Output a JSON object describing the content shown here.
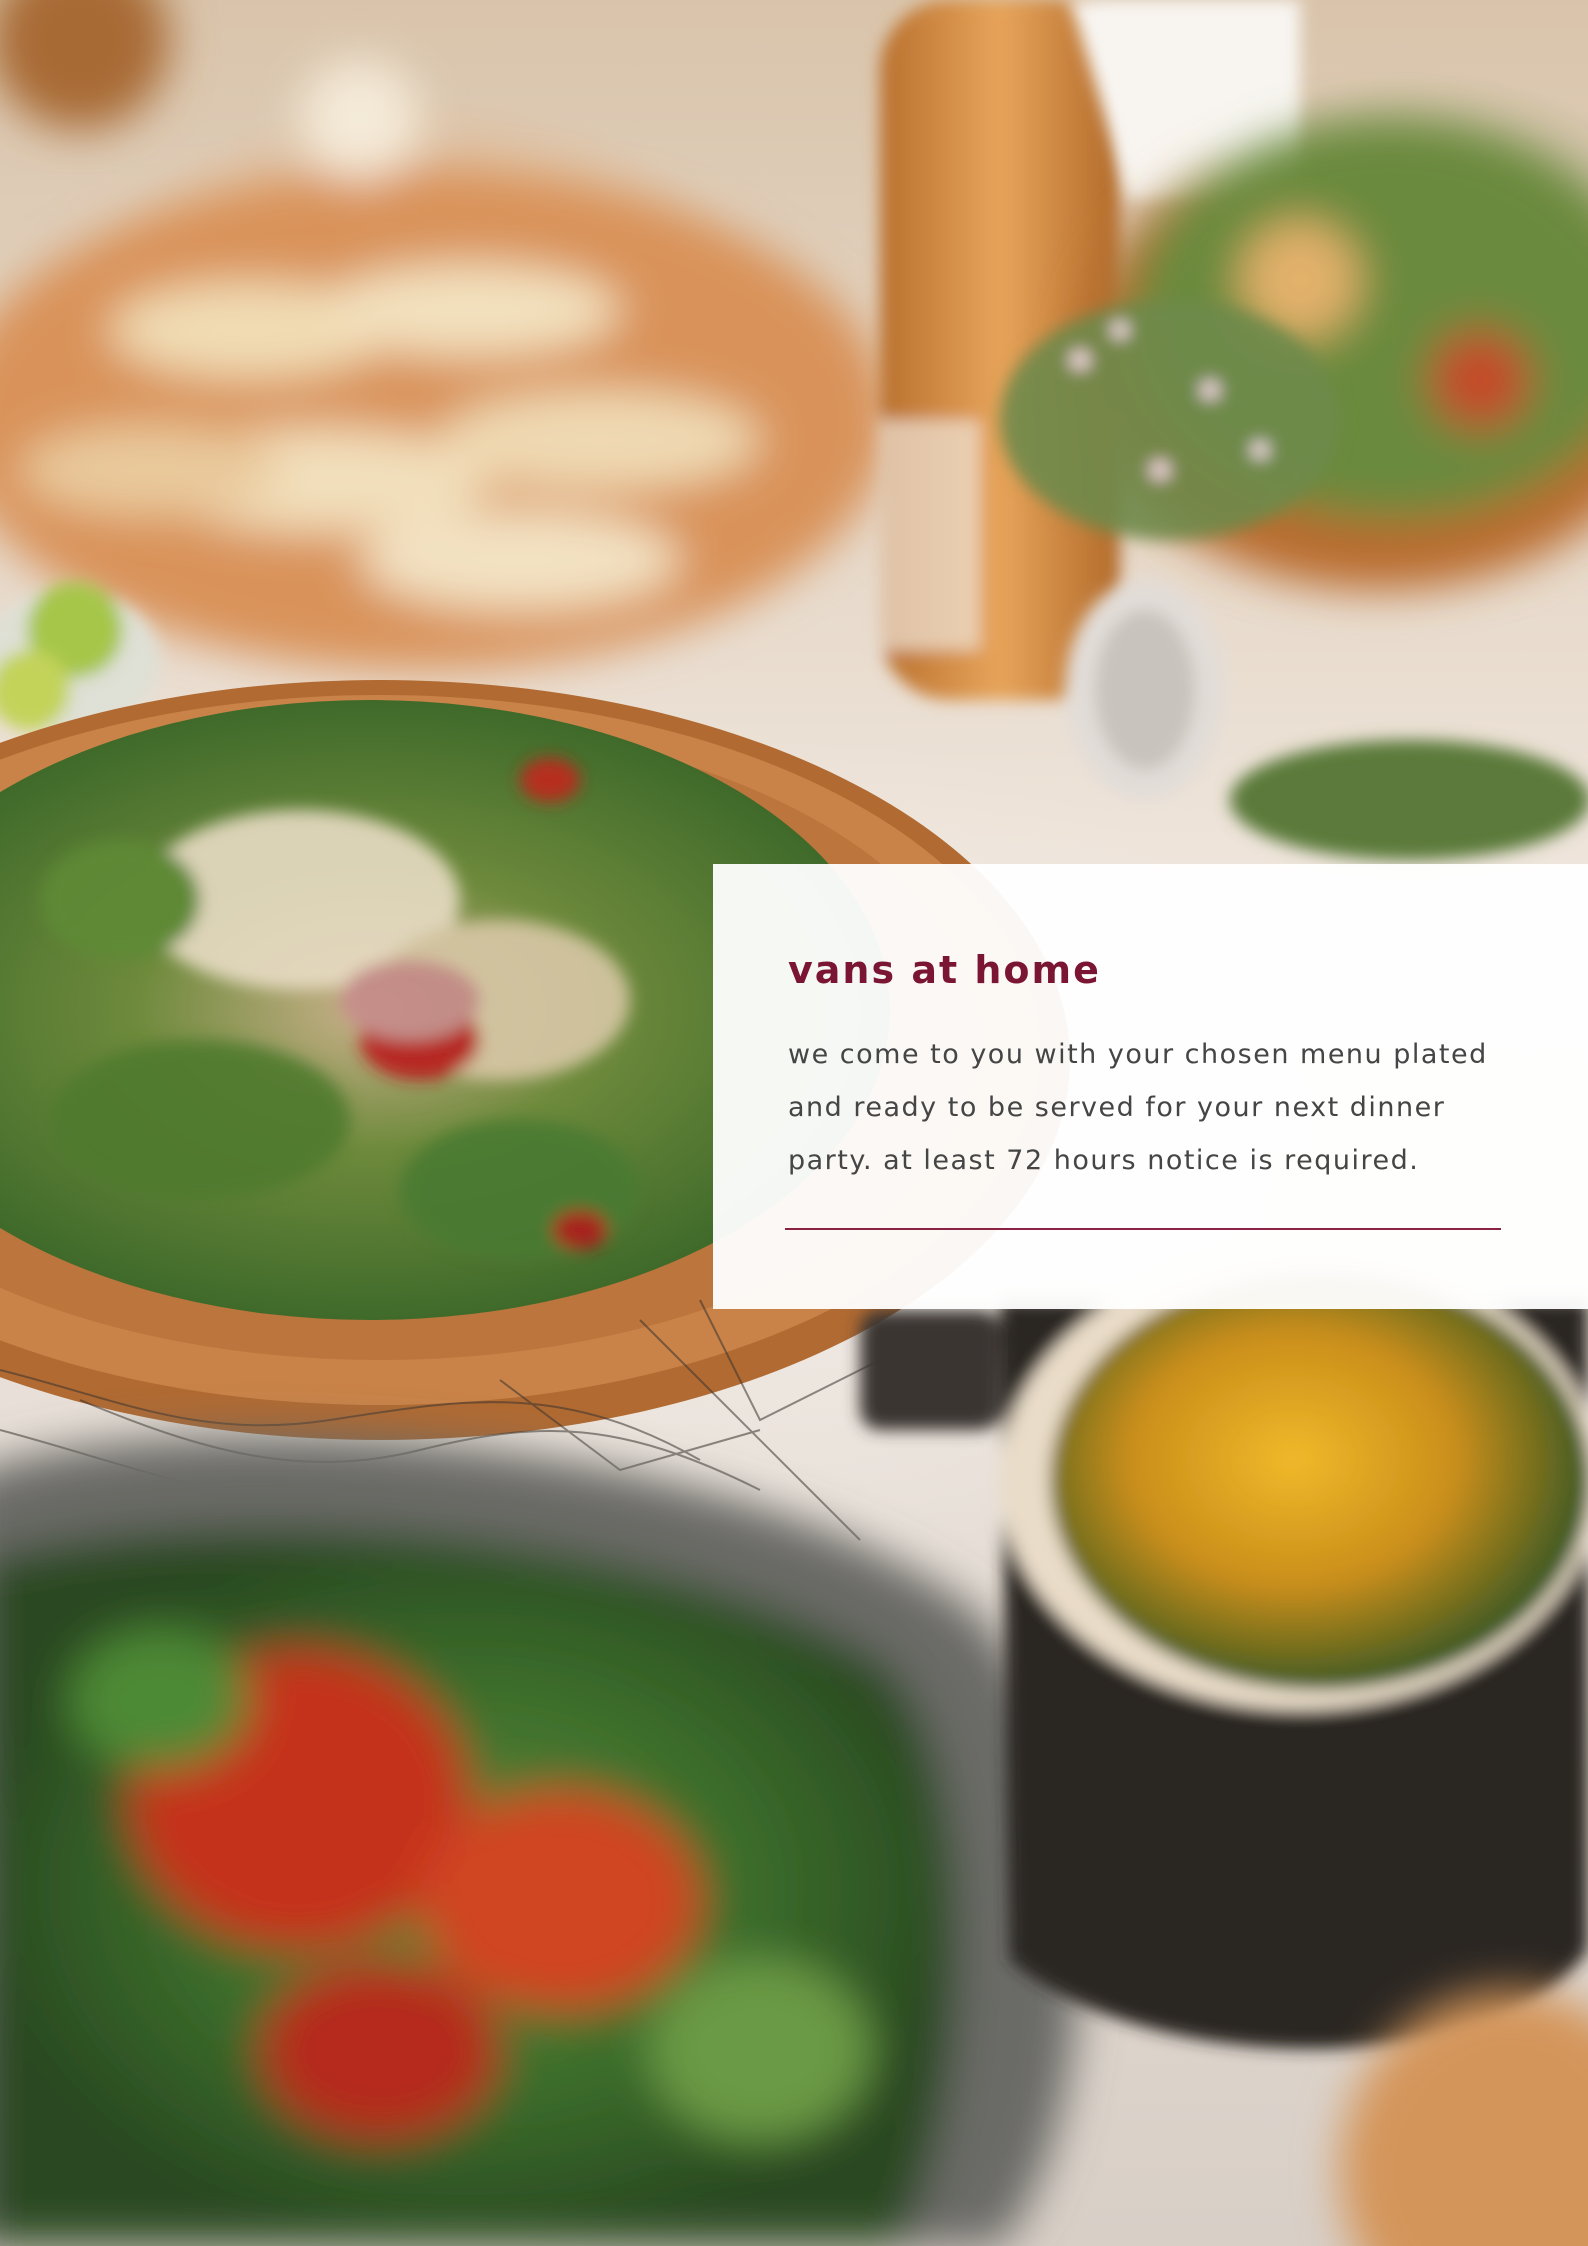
{
  "card": {
    "title": "vans at home",
    "body": "we come to you with your chosen menu plated and ready to be served for your next dinner party. at least 72 hours notice is required.",
    "title_color": "#7a1634",
    "rule_color": "#8b2244"
  },
  "photo": {
    "description_icon": "food-photo"
  }
}
